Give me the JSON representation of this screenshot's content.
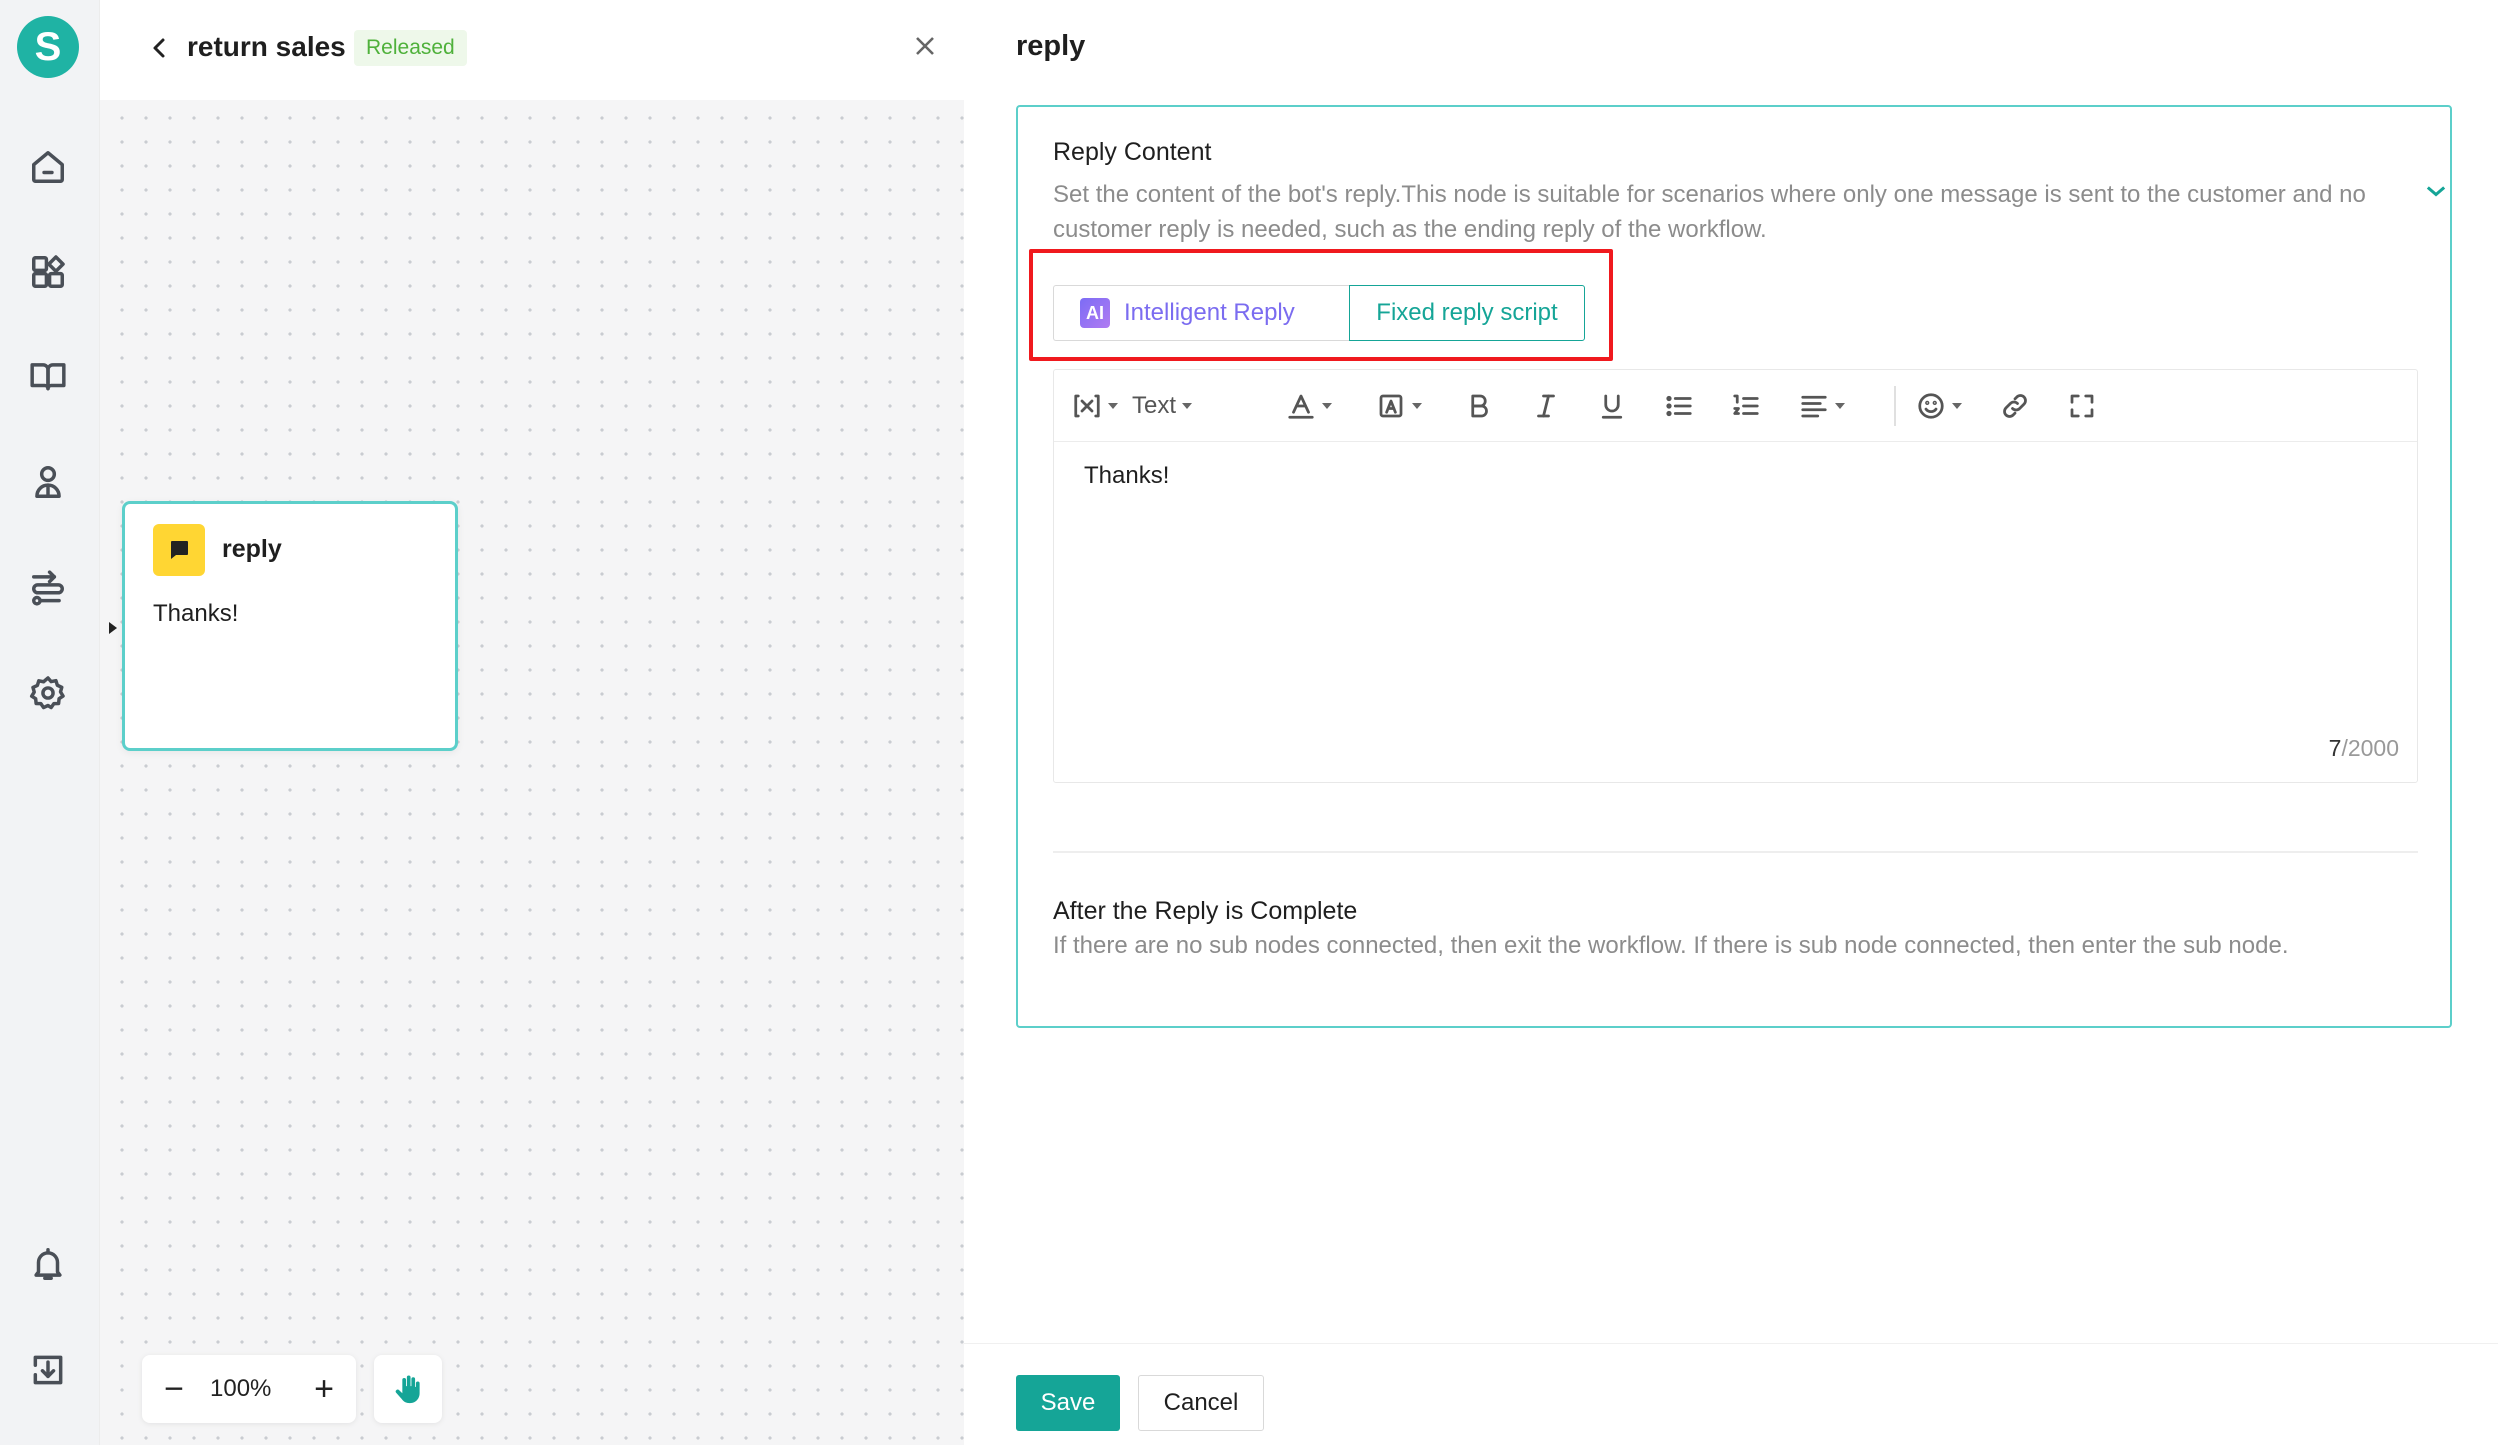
{
  "rail": {
    "logo_letter": "S",
    "items": [
      "home-icon",
      "apps-icon",
      "book-icon",
      "users-icon",
      "workflow-icon",
      "settings-icon",
      "bell-icon",
      "download-icon"
    ]
  },
  "canvas": {
    "title": "return sales",
    "status": "Released",
    "node": {
      "title": "reply",
      "text": "Thanks!"
    },
    "zoom": {
      "minus": "−",
      "level": "100%",
      "plus": "+"
    }
  },
  "panel": {
    "title": "reply",
    "reply_content": {
      "title": "Reply Content",
      "description": "Set the content of the bot's reply.This node is suitable for scenarios where only one message is sent to the customer and no customer reply is needed, such as the ending reply of the workflow.",
      "tabs": {
        "ai_badge": "AI",
        "ai_label": "Intelligent Reply",
        "fixed_label": "Fixed reply script",
        "selected": "Fixed reply script"
      },
      "toolbar": {
        "text_style": "Text"
      },
      "editor_text": "Thanks!",
      "char_count": "7",
      "char_max": "/2000"
    },
    "after_reply": {
      "title": "After the Reply is Complete",
      "description": "If there are no sub nodes connected, then exit the workflow. If there is sub node connected, then enter the sub node."
    },
    "footer": {
      "save": "Save",
      "cancel": "Cancel"
    }
  },
  "colors": {
    "brand": "#15a597",
    "node_border": "#5ccfca",
    "highlight": "#f0191e",
    "ai_purple": "#7b6cf0",
    "released_green": "#4fb13b"
  }
}
